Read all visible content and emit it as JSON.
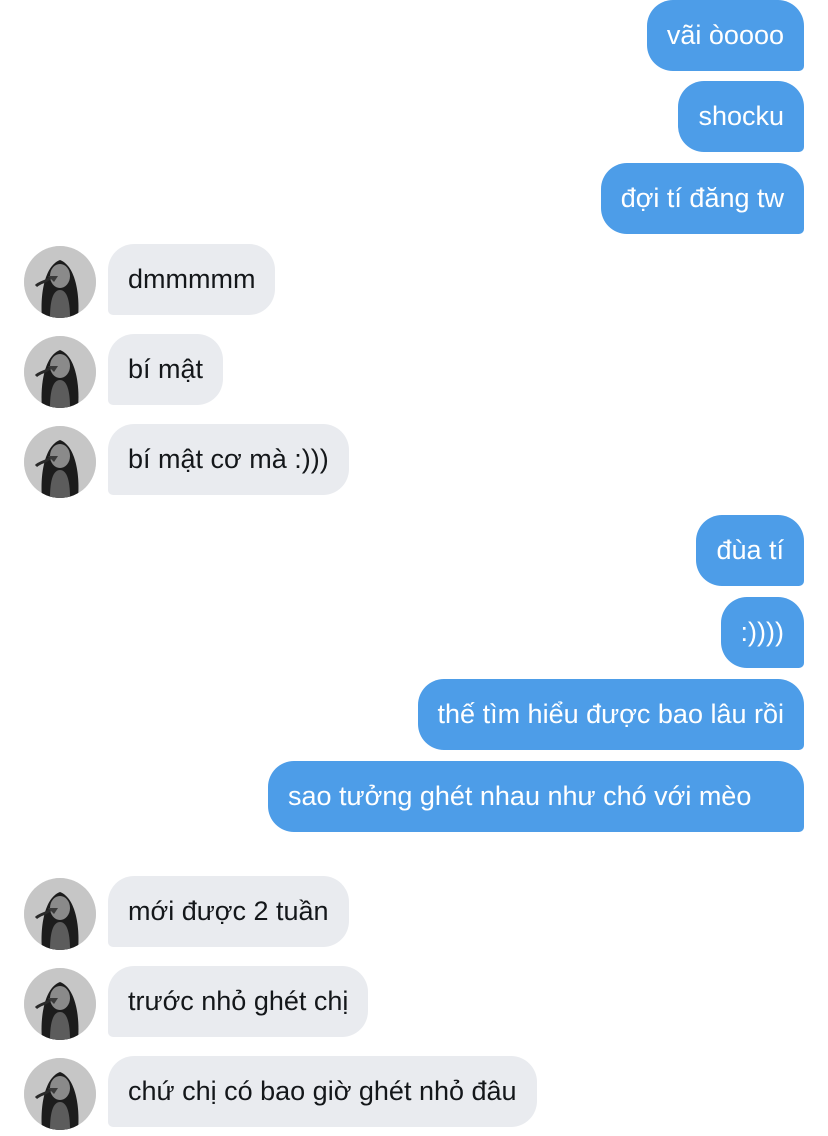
{
  "conversation": {
    "messages": [
      {
        "sender": "me",
        "text": "vãi òoooo"
      },
      {
        "sender": "me",
        "text": "shocku"
      },
      {
        "sender": "me",
        "text": "đợi tí đăng tw"
      },
      {
        "sender": "them",
        "text": "dmmmmm"
      },
      {
        "sender": "them",
        "text": "bí mật"
      },
      {
        "sender": "them",
        "text": "bí mật cơ mà :)))"
      },
      {
        "sender": "me",
        "text": "đùa tí"
      },
      {
        "sender": "me",
        "text": ":))))"
      },
      {
        "sender": "me",
        "text": "thế tìm hiểu được bao lâu rồi"
      },
      {
        "sender": "me",
        "text": "sao tưởng ghét nhau như chó với mèo"
      },
      {
        "sender": "them",
        "text": "mới được 2 tuần"
      },
      {
        "sender": "them",
        "text": "trước nhỏ ghét chị"
      },
      {
        "sender": "them",
        "text": "chứ chị có bao giờ ghét nhỏ đâu"
      }
    ]
  },
  "colors": {
    "outgoing_bubble": "#4d9de8",
    "incoming_bubble": "#e9ebef",
    "outgoing_text": "#ffffff",
    "incoming_text": "#14171a",
    "background": "#ffffff"
  },
  "icons": {
    "sender_avatar": "profile-photo"
  }
}
